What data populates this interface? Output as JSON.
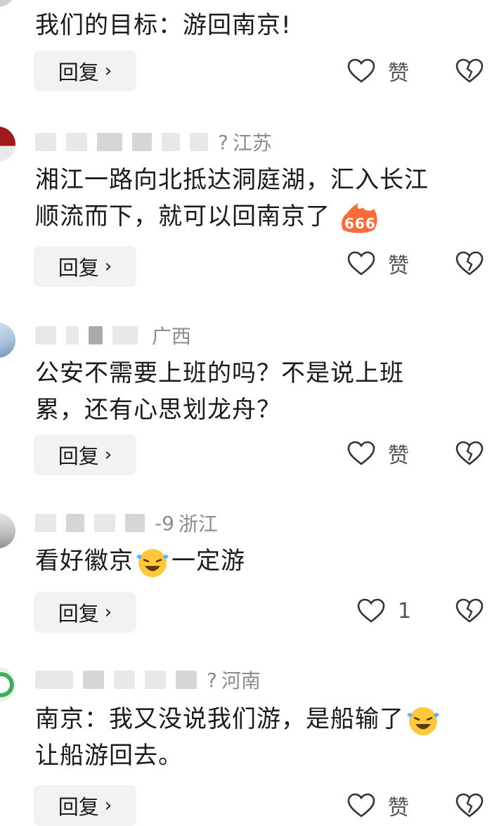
{
  "comments": [
    {
      "region": "",
      "meta_tail": "",
      "text": "我们的目标：游回南京!",
      "reply_label": "回复",
      "like_label": "赞"
    },
    {
      "region": "江苏",
      "meta_tail": "?",
      "text_line1": "湘江一路向北抵达洞庭湖，汇入长江",
      "text_line2": "顺流而下，就可以回南京了",
      "reply_label": "回复",
      "like_label": "赞"
    },
    {
      "region": "广西",
      "meta_tail": "",
      "text_line1": "公安不需要上班的吗？不是说上班",
      "text_line2": "累，还有心思划龙舟？",
      "reply_label": "回复",
      "like_label": "赞"
    },
    {
      "region": "浙江",
      "meta_tail": "-9",
      "text_before": "看好徽京",
      "text_after": "一定游",
      "reply_label": "回复",
      "like_label": "1"
    },
    {
      "region": "河南",
      "meta_tail": "?",
      "text_line1": "南京：我又没说我们游，是船输了",
      "text_line2": "让船游回去。",
      "reply_label": "回复",
      "like_label": "赞"
    }
  ],
  "icons": {
    "like": "heart-outline-icon",
    "dislike": "broken-heart-icon",
    "reply_chevron": "chevron-right-icon"
  },
  "colors": {
    "text": "#1a1a1a",
    "meta": "#8c8c8c",
    "button_bg": "#f2f2f2",
    "icon": "#333333"
  }
}
